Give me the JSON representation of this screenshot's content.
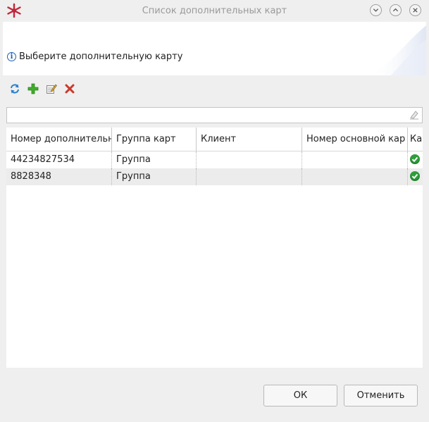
{
  "window": {
    "title": "Список дополнительных карт"
  },
  "header": {
    "message": "Выберите дополнительную карту",
    "info_icon": "info-icon"
  },
  "toolbar": {
    "refresh_icon": "refresh-icon",
    "add_icon": "add-icon",
    "edit_icon": "edit-icon",
    "delete_icon": "delete-icon"
  },
  "filter": {
    "value": "",
    "placeholder": ""
  },
  "table": {
    "columns": [
      "Номер дополнительн",
      "Группа карт",
      "Клиент",
      "Номер основной кар",
      "Ка"
    ],
    "rows": [
      {
        "number": "44234827534",
        "group": "Группа",
        "client": "",
        "main_number": "",
        "active": true
      },
      {
        "number": "8828348",
        "group": "Группа",
        "client": "",
        "main_number": "",
        "active": true
      }
    ]
  },
  "buttons": {
    "ok": "ОК",
    "cancel": "Отменить"
  },
  "colors": {
    "accent_blue": "#1a5fb4",
    "check_green": "#2e9e3a",
    "app_icon_red": "#c0263a"
  }
}
